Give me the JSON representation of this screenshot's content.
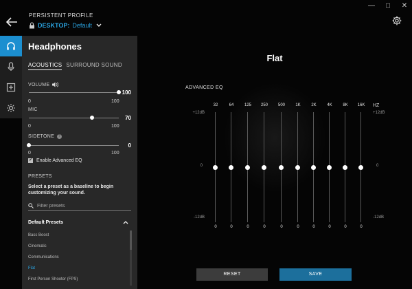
{
  "window": {
    "minimize": "—",
    "maximize": "□",
    "close": "✕"
  },
  "header": {
    "caption": "PERSISTENT PROFILE",
    "device": "DESKTOP:",
    "profile": "Default"
  },
  "panel": {
    "title": "Headphones",
    "tabs": [
      {
        "label": "ACOUSTICS",
        "active": true
      },
      {
        "label": "SURROUND SOUND",
        "active": false
      }
    ],
    "volume": {
      "label": "VOLUME",
      "value": "100",
      "min": "0",
      "max": "100",
      "level": 1.0
    },
    "mic": {
      "label": "MIC",
      "value": "70",
      "min": "0",
      "max": "100",
      "level": 0.7
    },
    "sidetone": {
      "label": "SIDETONE",
      "value": "0",
      "min": "0",
      "max": "100",
      "level": 0.0
    },
    "advanced_eq_check": {
      "label": "Enable Advanced EQ",
      "checked": true
    },
    "presets": {
      "heading": "PRESETS",
      "description": "Select a preset as a baseline to begin customizing your sound.",
      "filter_placeholder": "Filter presets",
      "group_label": "Default Presets",
      "items": [
        {
          "label": "Bass Boost",
          "selected": false
        },
        {
          "label": "Cinematic",
          "selected": false
        },
        {
          "label": "Communications",
          "selected": false
        },
        {
          "label": "Flat",
          "selected": true
        },
        {
          "label": "First Person Shooter (FPS)",
          "selected": false
        }
      ]
    }
  },
  "eq": {
    "title": "Flat",
    "section_label": "ADVANCED EQ",
    "unit": "HZ",
    "db_top": "+12dB",
    "db_mid": "0",
    "db_bottom": "-12dB",
    "bands": [
      {
        "freq": "32",
        "value": "0"
      },
      {
        "freq": "64",
        "value": "0"
      },
      {
        "freq": "125",
        "value": "0"
      },
      {
        "freq": "250",
        "value": "0"
      },
      {
        "freq": "500",
        "value": "0"
      },
      {
        "freq": "1K",
        "value": "0"
      },
      {
        "freq": "2K",
        "value": "0"
      },
      {
        "freq": "4K",
        "value": "0"
      },
      {
        "freq": "8K",
        "value": "0"
      },
      {
        "freq": "16K",
        "value": "0"
      }
    ]
  },
  "actions": {
    "reset": "RESET",
    "save": "SAVE"
  },
  "colors": {
    "accent": "#1c8fd0",
    "link": "#2aa3e0",
    "save": "#1c6f9c",
    "panel": "#282828"
  }
}
